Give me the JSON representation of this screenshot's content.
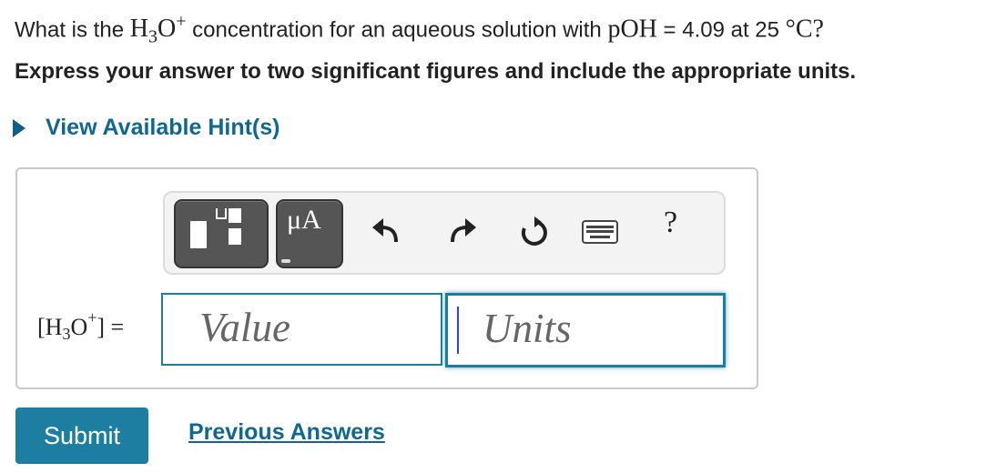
{
  "question": {
    "part1": "What is the ",
    "h": "H",
    "sub3": "3",
    "o": "O",
    "sup_plus": "+",
    "part2": " concentration for an aqueous solution with ",
    "poh": "pOH",
    "part3": " = 4.09 at 25 ",
    "degc": "°C",
    "qmark": "?"
  },
  "instruction": "Express your answer to two significant figures and include the appropriate units.",
  "hint_label": "View Available Hint(s)",
  "toolbar": {
    "units_label": "μA",
    "help_label": "?",
    "icons": [
      "templates-icon",
      "units-icon",
      "undo-icon",
      "redo-icon",
      "reset-icon",
      "keyboard-icon",
      "help-icon"
    ]
  },
  "answer": {
    "label_open": "[H",
    "label_sub": "3",
    "label_o": "O",
    "label_sup": "+",
    "label_close": "] =",
    "value_placeholder": "Value",
    "units_placeholder": "Units"
  },
  "submit_label": "Submit",
  "previous_answers_label": "Previous Answers",
  "colors": {
    "accent": "#1d7ea1",
    "link": "#11688f",
    "text": "#222222"
  }
}
